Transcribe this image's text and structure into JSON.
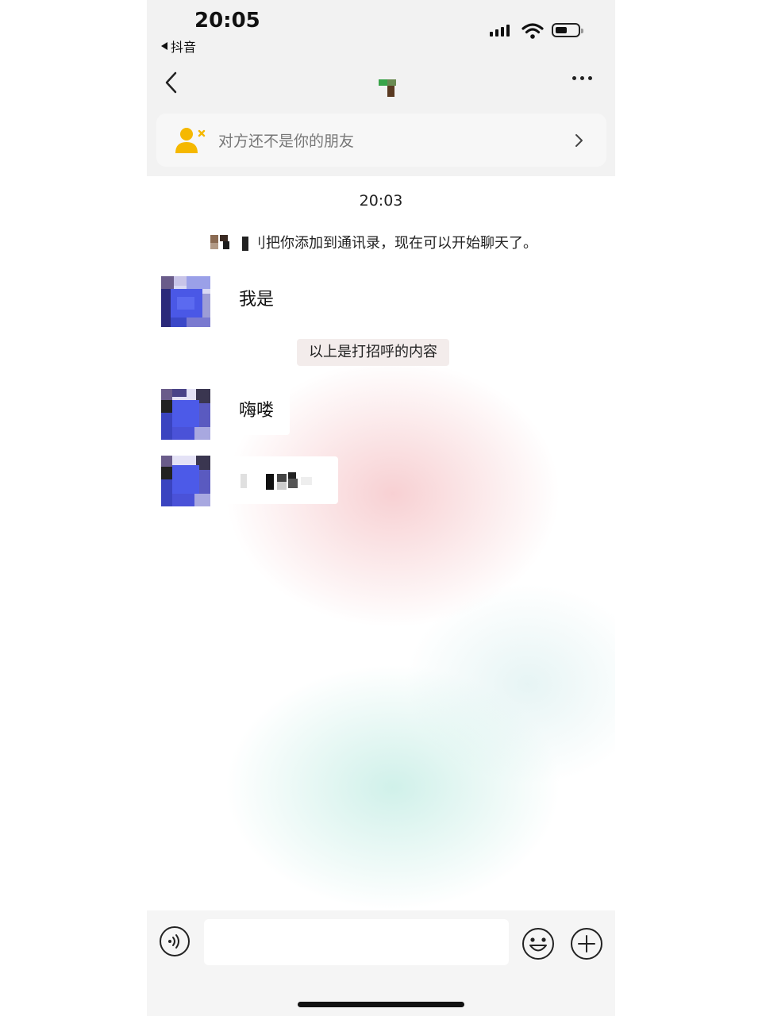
{
  "status_bar": {
    "time": "20:05",
    "back_app": "抖音"
  },
  "header": {
    "contact_name": "",
    "more_icon": "more-icon"
  },
  "banner": {
    "text": "对方还不是你的朋友",
    "icon": "user-not-friend-icon",
    "accent_color": "#f5b800"
  },
  "messages": {
    "timestamp": "20:03",
    "system_text": "刂把你添加到通讯录，现在可以开始聊天了。",
    "greeting_hint": "以上是打招呼的内容",
    "items": [
      {
        "text": "我是"
      },
      {
        "text": "嗨喽"
      },
      {
        "text": ""
      }
    ]
  },
  "input_bar": {
    "placeholder": "",
    "voice_icon": "voice-icon",
    "emoji_icon": "emoji-icon",
    "plus_icon": "plus-icon"
  }
}
